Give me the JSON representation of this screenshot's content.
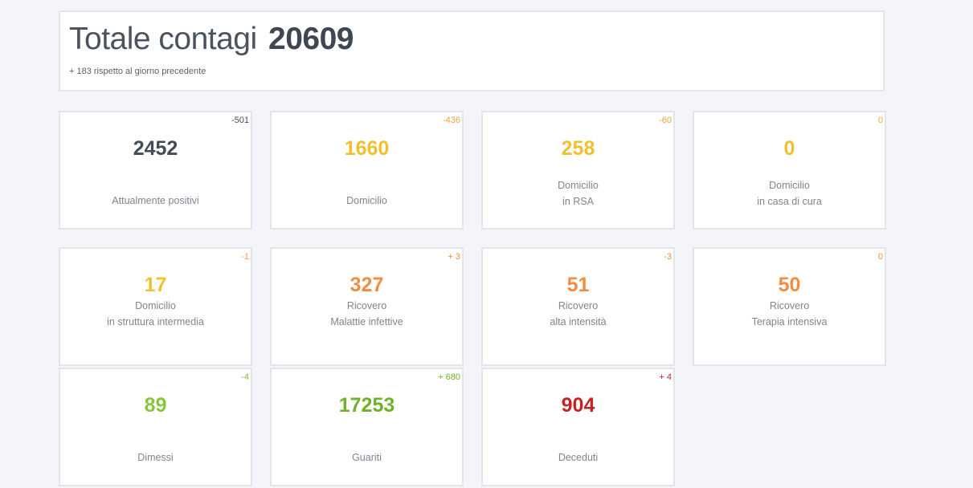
{
  "header": {
    "title_prefix": "Totale contagi",
    "total": "20609",
    "subtitle": "+ 183 rispetto al giorno precedente"
  },
  "colors": {
    "dark": "#434b56",
    "yellow": "#f0c12e",
    "orange": "#ef8e41",
    "green": "#7ac131",
    "red": "#c32323"
  },
  "cards": [
    {
      "value": "2452",
      "delta": "-501",
      "line1": "Attualmente positivi",
      "line2": "",
      "color": "#434b56",
      "delta_color": "#434b56"
    },
    {
      "value": "1660",
      "delta": "-436",
      "line1": "Domicilio",
      "line2": "",
      "color": "#f0c12e",
      "delta_color": "#f0a33a"
    },
    {
      "value": "258",
      "delta": "-60",
      "line1": "Domicilio",
      "line2": "in RSA",
      "color": "#f0c12e",
      "delta_color": "#f0a33a"
    },
    {
      "value": "0",
      "delta": "0",
      "line1": "Domicilio",
      "line2": "in casa di cura",
      "color": "#f0c12e",
      "delta_color": "#f0a33a"
    },
    {
      "value": "17",
      "delta": "-1",
      "line1": "Domicilio",
      "line2": "in struttura intermedia",
      "color": "#f0c12e",
      "delta_color": "#f0a33a"
    },
    {
      "value": "327",
      "delta": "+ 3",
      "line1": "Ricovero",
      "line2": "Malattie infettive",
      "color": "#ef8e41",
      "delta_color": "#ef8e41"
    },
    {
      "value": "51",
      "delta": "-3",
      "line1": "Ricovero",
      "line2": "alta intensità",
      "color": "#ef8e41",
      "delta_color": "#ef8e41"
    },
    {
      "value": "50",
      "delta": "0",
      "line1": "Ricovero",
      "line2": "Terapia intensiva",
      "color": "#ef8e41",
      "delta_color": "#ef8e41"
    },
    {
      "value": "89",
      "delta": "-4",
      "line1": "Dimessi",
      "line2": "",
      "color": "#86c53c",
      "delta_color": "#7ac131"
    },
    {
      "value": "17253",
      "delta": "+ 680",
      "line1": "Guariti",
      "line2": "",
      "color": "#6db22a",
      "delta_color": "#6db22a"
    },
    {
      "value": "904",
      "delta": "+ 4",
      "line1": "Deceduti",
      "line2": "",
      "color": "#c32323",
      "delta_color": "#c32323"
    }
  ]
}
